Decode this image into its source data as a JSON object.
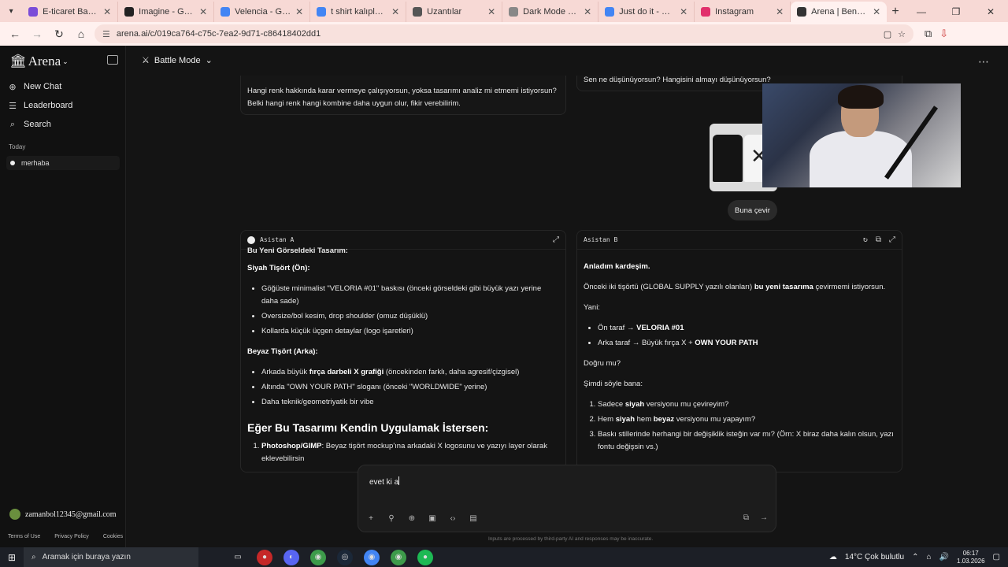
{
  "browser": {
    "tabs": [
      {
        "title": "E-ticaret Başlangıç R",
        "color": "#7a4dd8"
      },
      {
        "title": "Imagine - Grok",
        "color": "#222222"
      },
      {
        "title": "Velencia - Google'da",
        "color": "#4285f4"
      },
      {
        "title": "t shirt kalıpları owers",
        "color": "#4285f4"
      },
      {
        "title": "Uzantılar",
        "color": "#555555"
      },
      {
        "title": "Dark Mode - Chrome",
        "color": "#888888"
      },
      {
        "title": "Just do it - Google'd",
        "color": "#4285f4"
      },
      {
        "title": "Instagram",
        "color": "#e1306c"
      },
      {
        "title": "Arena | Benchmark &",
        "color": "#333333"
      }
    ],
    "url": "arena.ai/c/019ca764-c75c-7ea2-9d71-c86418402dd1"
  },
  "sidebar": {
    "logo": "Arena",
    "nav": [
      {
        "label": "New Chat",
        "icon": "plus-circle-icon"
      },
      {
        "label": "Leaderboard",
        "icon": "list-icon"
      },
      {
        "label": "Search",
        "icon": "search-icon"
      }
    ],
    "section_today": "Today",
    "chat_item": "merhaba",
    "user_email": "zamanbol12345@gmail.com",
    "footer": [
      "Terms of Use",
      "Privacy Policy",
      "Cookies"
    ]
  },
  "header": {
    "mode": "Battle Mode"
  },
  "prev": {
    "a_text": "Hangi renk hakkında karar vermeye çalışıyorsun, yoksa tasarımı analiz mi etmemi istiyorsun? Belki hangi renk hangi kombine daha uygun olur, fikir verebilirim.",
    "b_text": "Sen ne düşünüyorsun? Hangisini almayı düşünüyorsun?"
  },
  "user_msg": "Buna çevir",
  "assistant_a": {
    "name": "Asistan A",
    "cut_heading": "Bu Yeni Görseldeki Tasarım:",
    "black_heading": "Siyah Tişört (Ön):",
    "black_items": [
      "Göğüste minimalist \"VELORIA #01\" baskısı (önceki görseldeki gibi büyük yazı yerine daha sade)",
      "Oversize/bol kesim, drop shoulder (omuz düşüklü)",
      "Kollarda küçük üçgen detaylar (logo işaretleri)"
    ],
    "white_heading": "Beyaz Tişört (Arka):",
    "white_item1_pre": "Arkada büyük ",
    "white_item1_bold": "fırça darbeli X grafiği",
    "white_item1_post": " (öncekinden farklı, daha agresif/çizgisel)",
    "white_item2": "Altında \"OWN YOUR PATH\" sloganı (önceki \"WORLDWIDE\" yerine)",
    "white_item3": "Daha teknik/geometriyatik bir vibe",
    "apply_heading": "Eğer Bu Tasarımı Kendin Uygulamak İstersen:",
    "step1_bold": "Photoshop/GIMP",
    "step1_text": ": Beyaz tişört mockup'ına arkadaki X logosunu ve yazıyı layer olarak eklevebilirsin"
  },
  "assistant_b": {
    "name": "Asistan B",
    "p1": "Anladım kardeşim.",
    "p2_pre": "Önceki iki tişörtü (GLOBAL SUPPLY yazılı olanları) ",
    "p2_bold": "bu yeni tasarıma",
    "p2_post": " çevirmemi istiyorsun.",
    "p3": "Yani:",
    "bullet1_pre": "Ön taraf → ",
    "bullet1_bold": "VELORIA #01",
    "bullet2_pre": "Arka taraf → Büyük fırça X + ",
    "bullet2_bold": "OWN YOUR PATH",
    "p4": "Doğru mu?",
    "p5": "Şimdi söyle bana:",
    "q1_pre": "Sadece ",
    "q1_bold": "siyah",
    "q1_post": " versiyonu mu çevireyim?",
    "q2_pre": "Hem ",
    "q2_bold1": "siyah",
    "q2_mid": " hem ",
    "q2_bold2": "beyaz",
    "q2_post": " versiyonu mu yapayım?",
    "q3": "Baskı stillerinde herhangi bir değişiklik isteğin var mı? (Örn: X biraz daha kalın olsun, yazı fontu değişsin vs.)"
  },
  "composer": {
    "text": "evet ki a",
    "disclaimer": "Inputs are processed by third-party AI and responses may be inaccurate."
  },
  "taskbar": {
    "search_placeholder": "Aramak için buraya yazın",
    "weather": "14°C  Çok bulutlu",
    "time": "06:17",
    "date": "1.03.2026"
  }
}
